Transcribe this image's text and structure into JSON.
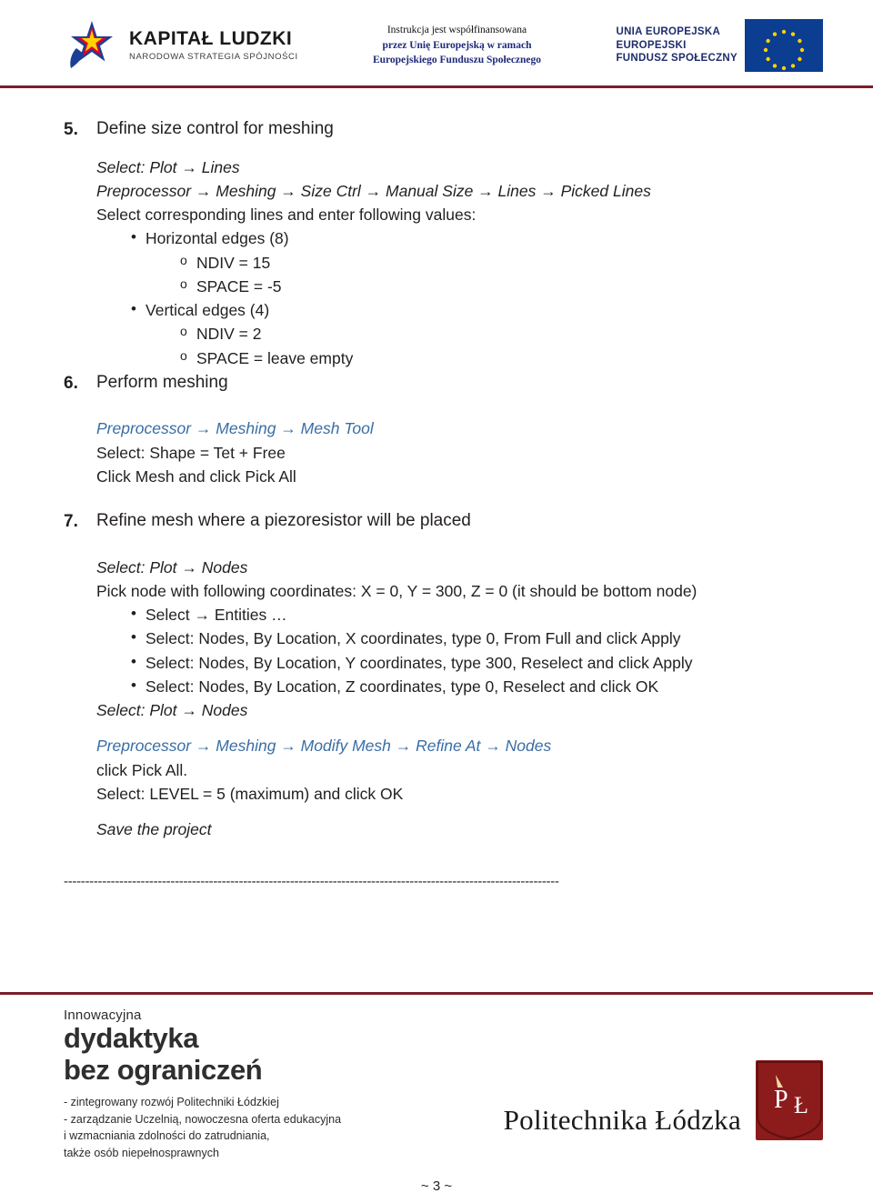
{
  "header": {
    "kapital_ludzki": {
      "title": "KAPITAŁ LUDZKI",
      "subtitle": "NARODOWA STRATEGIA SPÓJNOŚCI",
      "icon": "star-logo-icon"
    },
    "center_note": {
      "line1": "Instrukcja jest współfinansowana",
      "line2": "przez Unię Europejską w ramach",
      "line3": "Europejskiego Funduszu Społecznego"
    },
    "eu": {
      "line1": "UNIA EUROPEJSKA",
      "line2": "EUROPEJSKI",
      "line3": "FUNDUSZ SPOŁECZNY",
      "flag_icon": "eu-flag-icon"
    }
  },
  "content": {
    "step5": {
      "number": "5.",
      "title": "Define size control for meshing",
      "select_line": "Select: Plot → Lines",
      "path_line": "Preprocessor → Meshing → Size Ctrl → Manual Size → Lines → Picked Lines",
      "instruction": "Select corresponding lines and enter following values:",
      "bullets": [
        {
          "label": "Horizontal edges (8)",
          "sub": [
            "NDIV = 15",
            "SPACE = -5"
          ]
        },
        {
          "label": "Vertical edges (4)",
          "sub": [
            "NDIV = 2",
            "SPACE = leave empty"
          ]
        }
      ]
    },
    "step6": {
      "number": "6.",
      "title": "Perform meshing",
      "path_line": "Preprocessor → Meshing → Mesh Tool",
      "line2": "Select: Shape = Tet + Free",
      "line3": "Click Mesh and click Pick All"
    },
    "step7": {
      "number": "7.",
      "title": "Refine mesh where a piezoresistor will be placed",
      "select_line": "Select: Plot → Nodes",
      "pick_line": "Pick node with following coordinates: X = 0, Y = 300, Z = 0 (it should be bottom node)",
      "bullets": [
        "Select → Entities …",
        "Select: Nodes, By Location, X coordinates, type 0, From Full and click Apply",
        "Select: Nodes, By Location, Y coordinates, type 300, Reselect and click Apply",
        "Select: Nodes, By Location, Z coordinates, type 0, Reselect and click OK"
      ],
      "select_line2": "Select: Plot → Nodes",
      "path_line": "Preprocessor → Meshing → Modify Mesh → Refine At → Nodes",
      "line_click": "click Pick All.",
      "line_level": "Select: LEVEL = 5 (maximum) and click OK",
      "save": "Save the project"
    },
    "divider": "--------------------------------------------------------------------------------------------------------------------"
  },
  "footer": {
    "innowacyjna": "Innowacyjna",
    "big_line1": "dydaktyka",
    "big_line2": "bez ograniczeń",
    "small_lines": [
      "- zintegrowany rozwój Politechniki Łódzkiej",
      "- zarządzanie Uczelnią,  nowoczesna oferta edukacyjna",
      "i wzmacniania zdolności do zatrudniania,",
      "także osób niepełnosprawnych"
    ],
    "university": "Politechnika Łódzka",
    "crest_icon": "university-crest-icon",
    "page_number": "~ 3 ~"
  },
  "colors": {
    "rule": "#7b1f2b",
    "link_blue": "#3a6ea5",
    "eu_blue": "#0b3d91",
    "crest_red": "#8c1b1b"
  }
}
